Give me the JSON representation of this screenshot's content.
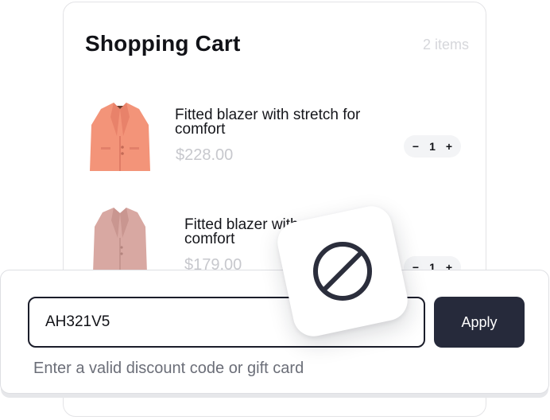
{
  "cart": {
    "title": "Shopping Cart",
    "item_count": "2 items",
    "items": [
      {
        "name": "Fitted blazer with stretch for comfort",
        "price": "$228.00",
        "quantity": "1",
        "decrement": "−",
        "increment": "+",
        "image_icon": "coral-blazer",
        "color": "#f4977f"
      },
      {
        "name": "Fitted blazer with stretch for comfort",
        "price": "$179.00",
        "quantity": "1",
        "decrement": "−",
        "increment": "+",
        "image_icon": "dusty-pink-blazer",
        "color": "#d9aaa4"
      }
    ]
  },
  "discount": {
    "code_value": "AH321V5",
    "apply_label": "Apply",
    "error_message": "Enter a valid discount code or gift card",
    "status_icon": "blocked-icon"
  },
  "colors": {
    "accent_dark": "#262a3b",
    "muted_text": "#c7c8cd"
  }
}
